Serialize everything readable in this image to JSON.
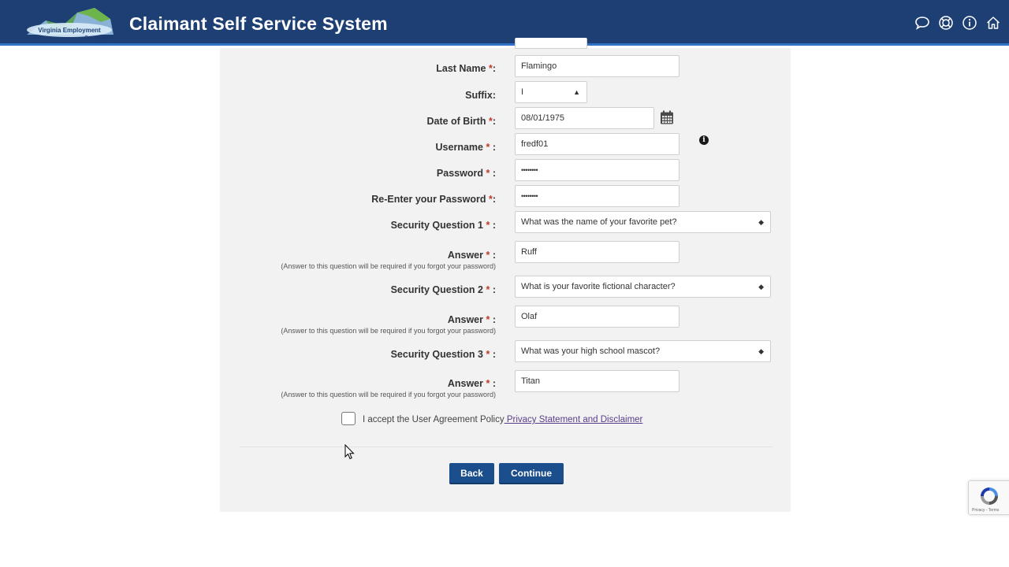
{
  "header": {
    "logo_text": "Virginia Employment Commission",
    "title": "Claimant Self Service System",
    "icons": [
      "chat-icon",
      "help-icon",
      "info-icon",
      "home-icon"
    ]
  },
  "form": {
    "last_name": {
      "label": "Last Name",
      "value": "Flamingo"
    },
    "suffix": {
      "label": "Suffix:",
      "value": "I"
    },
    "dob": {
      "label": "Date of Birth",
      "value": "08/01/1975"
    },
    "username": {
      "label": "Username",
      "value": "fredf01"
    },
    "password": {
      "label": "Password",
      "value": "••••••••"
    },
    "reenter_password": {
      "label": "Re-Enter your Password",
      "value": "••••••••"
    },
    "sq1": {
      "label": "Security Question 1",
      "value": "What was the name of your favorite pet?"
    },
    "ans1": {
      "label": "Answer",
      "value": "Ruff"
    },
    "sq2": {
      "label": "Security Question 2",
      "value": "What is your favorite fictional character?"
    },
    "ans2": {
      "label": "Answer",
      "value": "Olaf"
    },
    "sq3": {
      "label": "Security Question 3",
      "value": "What was your high school mascot?"
    },
    "ans3": {
      "label": "Answer",
      "value": "Titan"
    },
    "answer_hint": "(Answer to this question will be required if you forgot your password)",
    "required_mark": "*",
    "colon": ":"
  },
  "agreement": {
    "text": "I accept the User Agreement Policy",
    "link": " Privacy Statement and Disclaimer"
  },
  "buttons": {
    "back": "Back",
    "continue": "Continue"
  },
  "recaptcha": {
    "footer": "Privacy - Terms"
  }
}
